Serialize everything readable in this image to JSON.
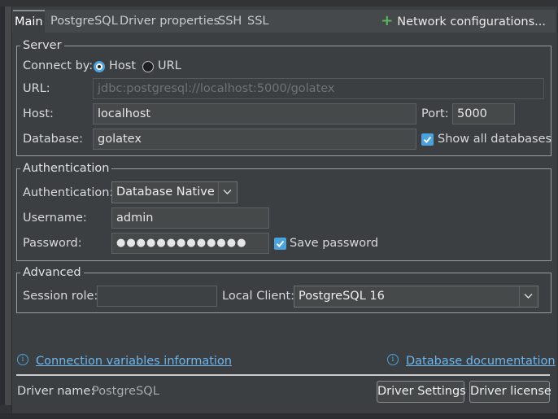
{
  "tabs": [
    {
      "label": "Main",
      "active": true
    },
    {
      "label": "PostgreSQL"
    },
    {
      "label": "Driver properties"
    },
    {
      "label": "SSH"
    },
    {
      "label": "SSL"
    }
  ],
  "network_configurations": "Network configurations...",
  "server": {
    "legend": "Server",
    "connect_by_label": "Connect by:",
    "options": [
      "Host",
      "URL"
    ],
    "selected": "Host",
    "url_label": "URL:",
    "url_value": "jdbc:postgresql://localhost:5000/golatex",
    "host_label": "Host:",
    "host_value": "localhost",
    "port_label": "Port:",
    "port_value": "5000",
    "database_label": "Database:",
    "database_value": "golatex",
    "show_all_databases": "Show all databases",
    "show_all_databases_checked": true
  },
  "authentication": {
    "legend": "Authentication",
    "auth_label": "Authentication:",
    "auth_value": "Database Native",
    "username_label": "Username:",
    "username_value": "admin",
    "password_label": "Password:",
    "password_masked": "●●●●●●●●●●●●●",
    "save_password": "Save password",
    "save_password_checked": true
  },
  "advanced": {
    "legend": "Advanced",
    "session_role_label": "Session role:",
    "session_role_value": "",
    "local_client_label": "Local Client:",
    "local_client_value": "PostgreSQL 16"
  },
  "links": {
    "connection_variables": "Connection variables information",
    "database_documentation": "Database documentation"
  },
  "footer": {
    "driver_name_label": "Driver name:",
    "driver_name_value": "PostgreSQL",
    "driver_settings": "Driver Settings",
    "driver_license": "Driver license"
  },
  "colors": {
    "background": "#3c3f41",
    "accent": "#4aa3df",
    "link": "#6bb7ee",
    "plus": "#5cb85c"
  },
  "icons": [
    "plus-icon",
    "info-icon",
    "chevron-down-icon",
    "checkmark-icon"
  ]
}
